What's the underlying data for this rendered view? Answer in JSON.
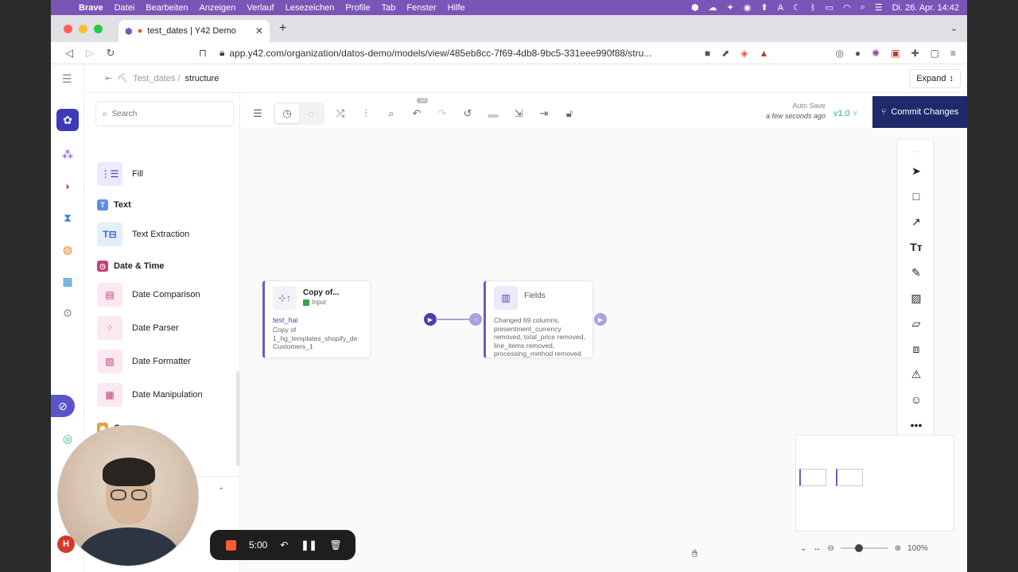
{
  "menubar": {
    "app": "Brave",
    "items": [
      "Datei",
      "Bearbeiten",
      "Anzeigen",
      "Verlauf",
      "Lesezeichen",
      "Profile",
      "Tab",
      "Fenster",
      "Hilfe"
    ],
    "datetime": "Di. 26. Apr. 14:42"
  },
  "browser": {
    "tab_title": "test_dates | Y42 Demo",
    "url": "app.y42.com/organization/datos-demo/models/view/485eb8cc-7f69-4db8-9bc5-331eee990f88/stru..."
  },
  "app": {
    "breadcrumb": {
      "parent": "Test_dates /",
      "current": "structure"
    },
    "expand_label": "Expand",
    "search": {
      "placeholder": "Search"
    },
    "panel": {
      "fill_label": "Fill",
      "section_text": "Text",
      "text_extraction": "Text Extraction",
      "section_datetime": "Date & Time",
      "date_comparison": "Date Comparison",
      "date_parser": "Date Parser",
      "date_formatter": "Date Formatter",
      "date_manipulation": "Date Manipulation",
      "section_geo": "Geo"
    },
    "autosave": {
      "label": "Auto Save",
      "time": "a few seconds ago"
    },
    "version": "v1.0",
    "commit_label": "Commit Changes",
    "history_badge": "10",
    "nodes": {
      "input": {
        "title": "Copy of...",
        "type": "Input",
        "name": "test_hai",
        "desc": "Copy of\n1_hg_templates_shopify_de\nCustomers_1"
      },
      "fields": {
        "title": "Fields",
        "desc": "Changed 69 columns,\npresentment_currency\nremoved, total_price removed,\nline_items removed,\nprocessing_method removed"
      }
    },
    "zoom": "100%"
  },
  "recording": {
    "timer": "5:00",
    "user_initial": "H"
  },
  "colors": {
    "menubar": "#7b54b8",
    "commit": "#1f2a6b",
    "accent": "#6a5acd",
    "version": "#2fb58a",
    "rec_stop": "#ff5b35"
  }
}
